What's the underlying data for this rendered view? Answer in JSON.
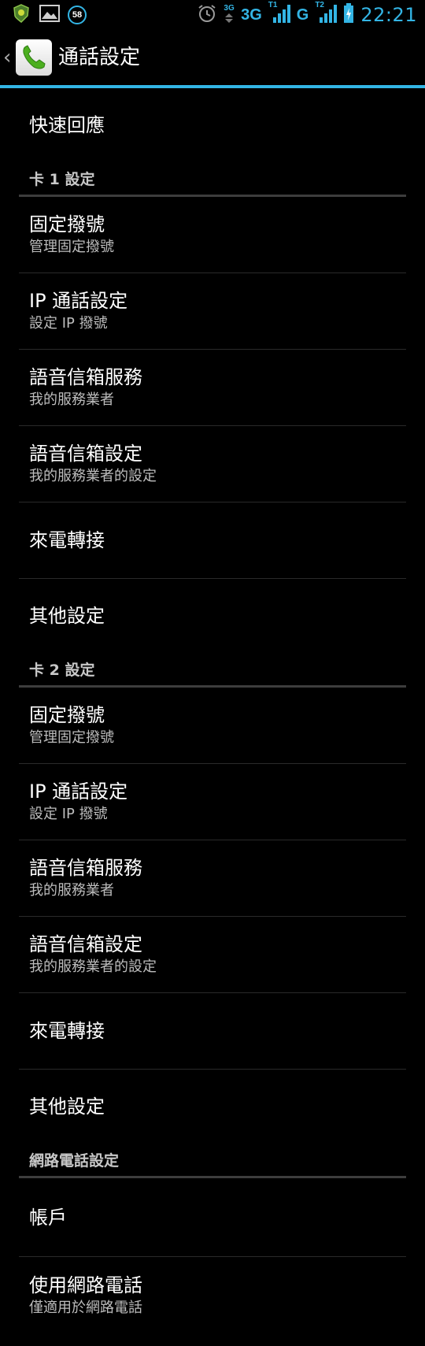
{
  "status_bar": {
    "badge_count": "58",
    "network_3g_small": "3G",
    "network_3g": "3G",
    "sim1_tag": "T1",
    "network_g": "G",
    "sim2_tag": "T2",
    "time": "22:21",
    "accent_color": "#33b5e5",
    "icons": [
      "shield-app-icon",
      "picture-icon",
      "alarm-icon",
      "signal-icon",
      "battery-charging-icon"
    ]
  },
  "action_bar": {
    "title": "通話設定",
    "icon": "phone-icon",
    "back_glyph": "‹"
  },
  "top_items": [
    {
      "title": "快速回應"
    }
  ],
  "sections": [
    {
      "header": "卡 1 設定",
      "items": [
        {
          "title": "固定撥號",
          "summary": "管理固定撥號"
        },
        {
          "title": "IP 通話設定",
          "summary": "設定 IP 撥號"
        },
        {
          "title": "語音信箱服務",
          "summary": "我的服務業者"
        },
        {
          "title": "語音信箱設定",
          "summary": "我的服務業者的設定"
        },
        {
          "title": "來電轉接"
        },
        {
          "title": "其他設定"
        }
      ]
    },
    {
      "header": "卡 2 設定",
      "items": [
        {
          "title": "固定撥號",
          "summary": "管理固定撥號"
        },
        {
          "title": "IP 通話設定",
          "summary": "設定 IP 撥號"
        },
        {
          "title": "語音信箱服務",
          "summary": "我的服務業者"
        },
        {
          "title": "語音信箱設定",
          "summary": "我的服務業者的設定"
        },
        {
          "title": "來電轉接"
        },
        {
          "title": "其他設定"
        }
      ]
    },
    {
      "header": "網路電話設定",
      "items": [
        {
          "title": "帳戶"
        },
        {
          "title": "使用網路電話",
          "summary": "僅適用於網路電話"
        }
      ]
    }
  ]
}
